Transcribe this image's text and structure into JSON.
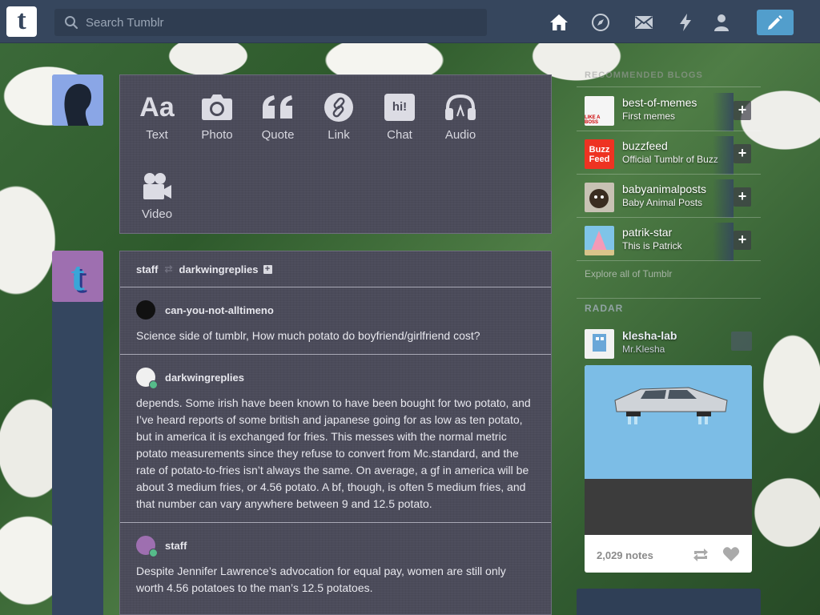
{
  "topbar": {
    "logo_letter": "t",
    "search_placeholder": "Search Tumblr",
    "nav_icons": [
      "home-icon",
      "explore-icon",
      "inbox-icon",
      "activity-icon",
      "account-icon"
    ],
    "compose_icon": "pencil-icon",
    "accent_color": "#529ecc"
  },
  "post_types": [
    {
      "label": "Text",
      "icon": "text-icon",
      "glyph": "Aa"
    },
    {
      "label": "Photo",
      "icon": "camera-icon",
      "glyph": ""
    },
    {
      "label": "Quote",
      "icon": "quote-icon",
      "glyph": "“"
    },
    {
      "label": "Link",
      "icon": "link-icon",
      "glyph": ""
    },
    {
      "label": "Chat",
      "icon": "chat-icon",
      "glyph": "hi!"
    },
    {
      "label": "Audio",
      "icon": "headphones-icon",
      "glyph": ""
    },
    {
      "label": "Video",
      "icon": "video-camera-icon",
      "glyph": ""
    }
  ],
  "post": {
    "author": "staff",
    "reblogged_from": "darkwingreplies",
    "thread": [
      {
        "name": "can-you-not-alltimeno",
        "text": "Science side of tumblr, How much potato do boyfriend/girlfriend cost?"
      },
      {
        "name": "darkwingreplies",
        "text": "depends. Some irish have been known to have been bought for two potato, and I’ve heard reports of some british and japanese going for as low as ten potato, but in america it is exchanged for fries. This messes with the normal metric potato measurements since they refuse to convert from Mc.standard, and the rate of potato-to-fries isn’t always the same. On average, a gf in america will be about 3 medium fries, or 4.56 potato. A bf, though, is often 5 medium fries, and that number can vary anywhere between 9 and 12.5 potato."
      },
      {
        "name": "staff",
        "text": "Despite Jennifer Lawrence’s advocation for equal pay, women are still only worth 4.56 potatoes to the man’s 12.5 potatoes."
      }
    ]
  },
  "sidebar": {
    "recommended_heading": "RECOMMENDED BLOGS",
    "recommended": [
      {
        "name": "best-of-memes",
        "subtitle": "First memes",
        "avatar_text": "LIKE A BOSS"
      },
      {
        "name": "buzzfeed",
        "subtitle": "Official Tumblr of Buzz",
        "avatar_text": "Buzz Feed"
      },
      {
        "name": "babyanimalposts",
        "subtitle": "Baby Animal Posts",
        "avatar_text": ""
      },
      {
        "name": "patrik-star",
        "subtitle": "This is Patrick",
        "avatar_text": ""
      }
    ],
    "follow_glyph": "+",
    "explore_link": "Explore all of Tumblr",
    "radar_heading": "RADAR",
    "radar": {
      "name": "klesha-lab",
      "subtitle": "Mr.Klesha",
      "notes": "2,029 notes"
    }
  }
}
